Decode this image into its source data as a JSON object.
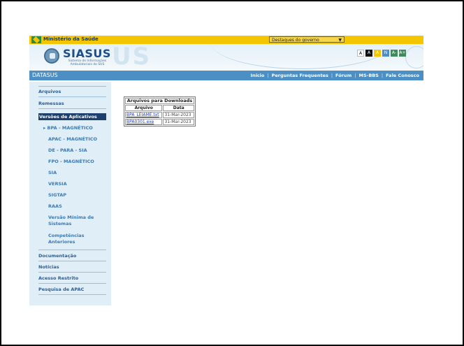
{
  "gov_bar": {
    "ministry": "Ministério da Saúde",
    "dropdown_value": "Destaques do governo"
  },
  "header": {
    "logo_title": "SIASUS",
    "logo_subtitle": "Sistema de Informações Ambulatoriais do SUS",
    "accessibility": [
      "A",
      "A",
      "A",
      "N",
      "A-",
      "A+"
    ]
  },
  "navbar": {
    "brand": "DATASUS",
    "links": [
      "Início",
      "Perguntas Frequentes",
      "Fórum",
      "MS-BBS",
      "Fale Conosco"
    ]
  },
  "sidebar": {
    "items": [
      "Arquivos",
      "Remessas",
      "Versões de Aplicativos"
    ],
    "subitems": [
      "BPA - MAGNÉTICO",
      "APAC - MAGNÉTICO",
      "DE - PARA - SIA",
      "FPO - MAGNÉTICO",
      "SIA",
      "VERSIA",
      "SIGTAP",
      "RAAS",
      "Versão Mínima de Sistemas",
      "Competências Anteriores"
    ],
    "bottom_items": [
      "Documentação",
      "Notícias",
      "Acesso Restrito",
      "Pesquisa de APAC"
    ]
  },
  "downloads": {
    "caption": "Arquivos para Downloads",
    "headers": [
      "Arquivo",
      "Data"
    ],
    "rows": [
      [
        "BPA_LEIAME.txt",
        "31-Mar-2023"
      ],
      [
        "BPA0301.exe",
        "31-Mar-2023"
      ]
    ]
  },
  "colors": {
    "gov_yellow": "#f3c600",
    "nav_blue": "#4b8fc5",
    "sidebar_bg": "#dfeef7",
    "active_bg": "#1c3f6e",
    "link_blue": "#1a3cc8"
  }
}
